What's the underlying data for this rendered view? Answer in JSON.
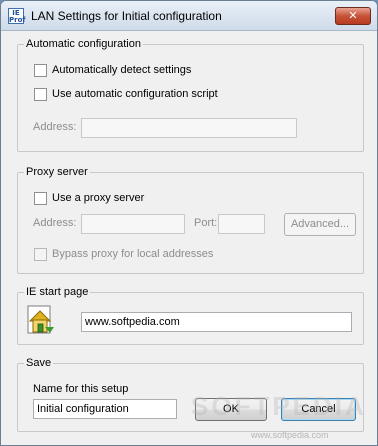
{
  "window": {
    "title": "LAN Settings for Initial configuration",
    "icon_text": "IE Prof",
    "close_symbol": "✕"
  },
  "automatic": {
    "group_title": "Automatic configuration",
    "detect_label": "Automatically detect settings",
    "detect_checked": false,
    "script_label": "Use automatic configuration script",
    "script_checked": false,
    "address_label": "Address:",
    "address_value": ""
  },
  "proxy": {
    "group_title": "Proxy server",
    "use_proxy_label": "Use a proxy server",
    "use_proxy_checked": false,
    "address_label": "Address:",
    "address_value": "",
    "port_label": "Port:",
    "port_value": "",
    "advanced_label": "Advanced...",
    "bypass_label": "Bypass proxy for local addresses",
    "bypass_checked": false
  },
  "start_page": {
    "group_title": "IE start page",
    "url_value": "www.softpedia.com",
    "icon": "home-page-icon"
  },
  "save": {
    "group_title": "Save",
    "name_label": "Name for this setup",
    "name_value": "Initial configuration",
    "ok_label": "OK",
    "cancel_label": "Cancel"
  },
  "watermark": {
    "text": "SOFTPEDIA",
    "url": "www.softpedia.com"
  },
  "colors": {
    "close_button": "#c75239",
    "group_border": "#c8c8c8",
    "disabled_text": "#8d8d8d"
  }
}
